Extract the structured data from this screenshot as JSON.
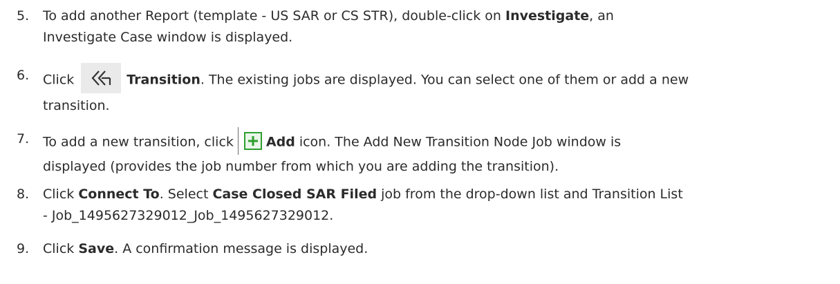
{
  "steps": [
    {
      "number": "5.",
      "line1_pre": "To add another Report (template - US SAR or CS STR), double-click on ",
      "line1_bold": "Investigate",
      "line1_post": ", an",
      "line2": "Investigate Case window is displayed."
    },
    {
      "number": "6.",
      "click": "Click",
      "icon": "double-chevron-left-icon",
      "bold": "Transition",
      "post": ". The existing jobs are displayed. You can select one of them or add a new",
      "line2": "transition."
    },
    {
      "number": "7.",
      "pre": "To add a new transition, click",
      "icon": "plus-box-icon",
      "bold": "Add",
      "post": " icon. The Add New Transition Node Job window is",
      "line2": "displayed (provides the job number from which you are adding the transition)."
    },
    {
      "number": "8.",
      "click": "Click ",
      "bold1": "Connect To",
      "mid1": ". Select ",
      "bold2": "Case Closed SAR Filed",
      "post": " job from the drop-down list and Transition List",
      "line2": "- Job_1495627329012_Job_1495627329012."
    },
    {
      "number": "9.",
      "click": "Click ",
      "bold": "Save",
      "post": ". A confirmation message is displayed."
    }
  ],
  "colors": {
    "text": "#2b2b2b",
    "add_icon_green": "#2e9e2e",
    "transition_icon_bg": "#eaeaea"
  }
}
